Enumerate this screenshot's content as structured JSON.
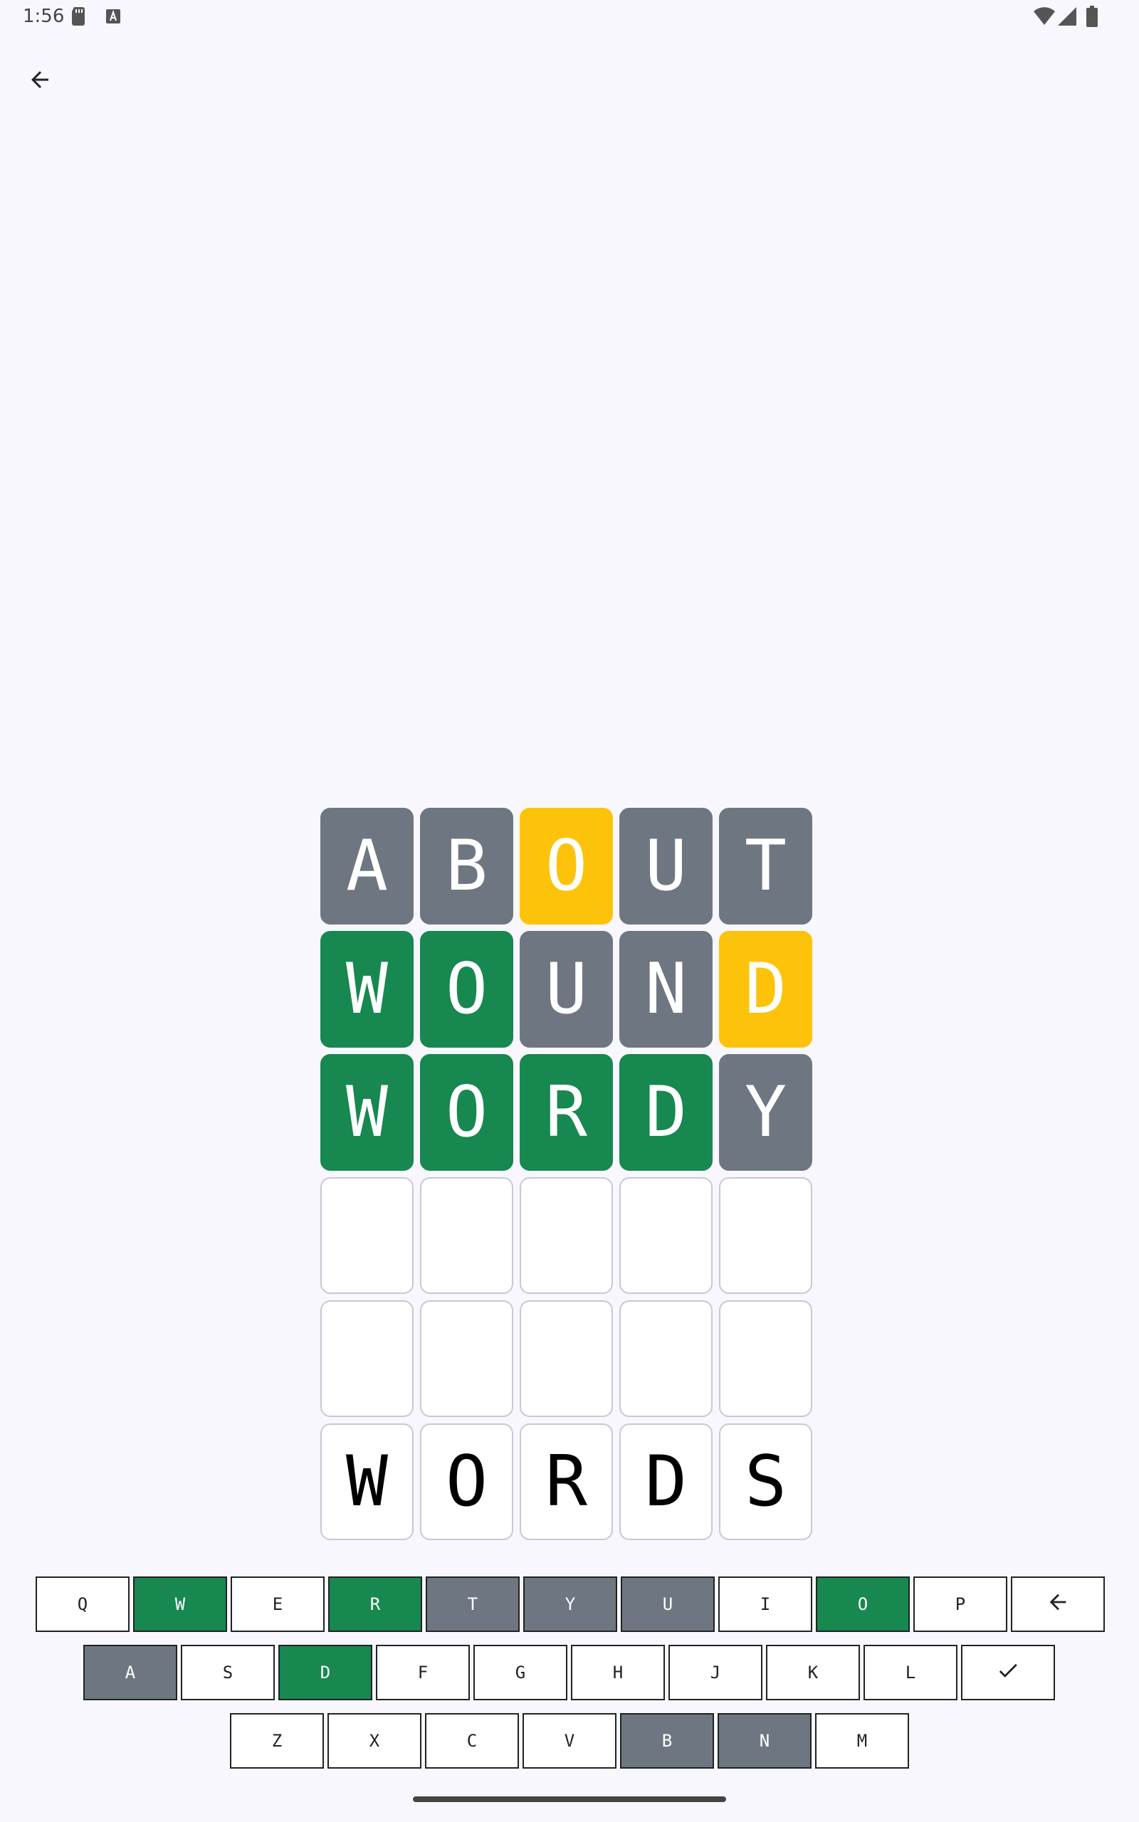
{
  "status_bar": {
    "time": "1:56",
    "icons": [
      "sd-card-icon",
      "a-notification-icon",
      "wifi-icon",
      "signal-icon",
      "battery-icon"
    ]
  },
  "toolbar": {
    "back_icon": "arrow-back-icon"
  },
  "board": {
    "rows": [
      [
        {
          "letter": "A",
          "state": "absent"
        },
        {
          "letter": "B",
          "state": "absent"
        },
        {
          "letter": "O",
          "state": "present"
        },
        {
          "letter": "U",
          "state": "absent"
        },
        {
          "letter": "T",
          "state": "absent"
        }
      ],
      [
        {
          "letter": "W",
          "state": "correct"
        },
        {
          "letter": "O",
          "state": "correct"
        },
        {
          "letter": "U",
          "state": "absent"
        },
        {
          "letter": "N",
          "state": "absent"
        },
        {
          "letter": "D",
          "state": "present"
        }
      ],
      [
        {
          "letter": "W",
          "state": "correct"
        },
        {
          "letter": "O",
          "state": "correct"
        },
        {
          "letter": "R",
          "state": "correct"
        },
        {
          "letter": "D",
          "state": "correct"
        },
        {
          "letter": "Y",
          "state": "absent"
        }
      ],
      [
        {
          "letter": "",
          "state": "empty"
        },
        {
          "letter": "",
          "state": "empty"
        },
        {
          "letter": "",
          "state": "empty"
        },
        {
          "letter": "",
          "state": "empty"
        },
        {
          "letter": "",
          "state": "empty"
        }
      ],
      [
        {
          "letter": "",
          "state": "empty"
        },
        {
          "letter": "",
          "state": "empty"
        },
        {
          "letter": "",
          "state": "empty"
        },
        {
          "letter": "",
          "state": "empty"
        },
        {
          "letter": "",
          "state": "empty"
        }
      ],
      [
        {
          "letter": "W",
          "state": "empty"
        },
        {
          "letter": "O",
          "state": "empty"
        },
        {
          "letter": "R",
          "state": "empty"
        },
        {
          "letter": "D",
          "state": "empty"
        },
        {
          "letter": "S",
          "state": "empty"
        }
      ]
    ]
  },
  "keyboard": {
    "rows": [
      [
        {
          "label": "Q",
          "state": "unused"
        },
        {
          "label": "W",
          "state": "correct"
        },
        {
          "label": "E",
          "state": "unused"
        },
        {
          "label": "R",
          "state": "correct"
        },
        {
          "label": "T",
          "state": "absent"
        },
        {
          "label": "Y",
          "state": "absent"
        },
        {
          "label": "U",
          "state": "absent"
        },
        {
          "label": "I",
          "state": "unused"
        },
        {
          "label": "O",
          "state": "correct"
        },
        {
          "label": "P",
          "state": "unused"
        },
        {
          "label": "",
          "state": "unused",
          "icon": "backspace-arrow-icon"
        }
      ],
      [
        {
          "label": "A",
          "state": "absent"
        },
        {
          "label": "S",
          "state": "unused"
        },
        {
          "label": "D",
          "state": "correct"
        },
        {
          "label": "F",
          "state": "unused"
        },
        {
          "label": "G",
          "state": "unused"
        },
        {
          "label": "H",
          "state": "unused"
        },
        {
          "label": "J",
          "state": "unused"
        },
        {
          "label": "K",
          "state": "unused"
        },
        {
          "label": "L",
          "state": "unused"
        },
        {
          "label": "",
          "state": "unused",
          "icon": "check-icon"
        }
      ],
      [
        {
          "label": "Z",
          "state": "unused"
        },
        {
          "label": "X",
          "state": "unused"
        },
        {
          "label": "C",
          "state": "unused"
        },
        {
          "label": "V",
          "state": "unused"
        },
        {
          "label": "B",
          "state": "absent"
        },
        {
          "label": "N",
          "state": "absent"
        },
        {
          "label": "M",
          "state": "unused"
        }
      ]
    ]
  },
  "colors": {
    "correct": "#178850",
    "present": "#fdc30a",
    "absent": "#6e7781",
    "background": "#f8f7fd"
  }
}
